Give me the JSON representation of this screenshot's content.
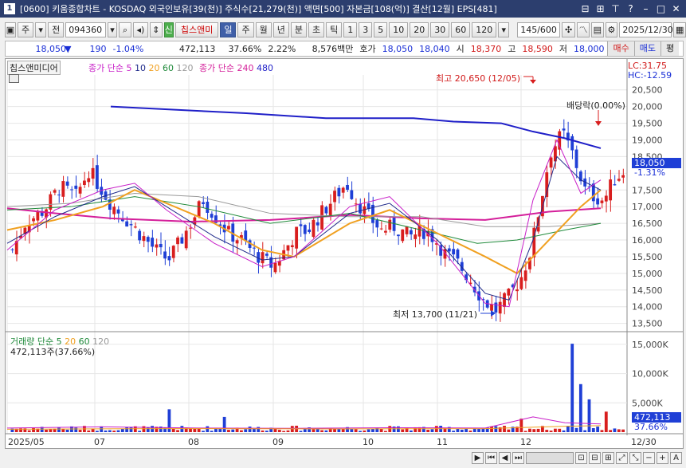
{
  "window": {
    "badge": "1",
    "title": "[0600] 키움종합차트 - KOSDAQ 외국인보유[39(천)] 주식수[21,279(천)] 액면[500] 자본금[108(억)] 결산[12월] EPS[481]"
  },
  "toolbar": {
    "type_btn": "주",
    "prev_btn": "전",
    "code": "094360",
    "company_btn": "칩스앤미디",
    "period_tabs": [
      "일",
      "주",
      "월",
      "년",
      "분",
      "초",
      "틱"
    ],
    "active_period": "일",
    "interval_btns": [
      "1",
      "3",
      "5",
      "10",
      "20",
      "30",
      "60",
      "120"
    ],
    "count": "145/600",
    "date": "2025/12/30"
  },
  "quote": {
    "price": "18,050",
    "change": "190",
    "change_pct": "-1.04%",
    "volume": "472,113",
    "vol_ratio": "37.66%",
    "turnover": "2.22%",
    "amount": "8,576백만",
    "bid_label": "호가",
    "ask": "18,050",
    "bid": "18,040",
    "open_label": "시",
    "open": "18,370",
    "high_label": "고",
    "high": "18,590",
    "low_label": "저",
    "low": "18,000",
    "buy_btn": "매수",
    "sell_btn": "매도",
    "eval_btn": "평"
  },
  "legend": {
    "name": "칩스앤미디어",
    "ma_short_label": "종가 단순 5",
    "ma_short_periods": [
      "10",
      "20",
      "60",
      "120"
    ],
    "ma_long_label": "종가 단순 240",
    "ma_long_periods": [
      "480"
    ],
    "lc": "LC:31.75",
    "hc": "HC:-12.59",
    "volume_label": "거래량 단순 5",
    "vol_ma": [
      "20",
      "60",
      "120"
    ],
    "volume_value": "472,113주(37.66%)"
  },
  "annotations": {
    "high": "최고 20,650 (12/05)",
    "low": "최저 13,700 (11/21)",
    "dividend": "배당락(0.00%)"
  },
  "price_axis": [
    "20,500",
    "20,000",
    "19,500",
    "19,000",
    "18,500",
    "18,000",
    "17,500",
    "17,000",
    "16,500",
    "16,000",
    "15,500",
    "15,000",
    "14,500",
    "14,000",
    "13,500"
  ],
  "current_price_box": "18,050",
  "current_pct_box": "-1.31%",
  "volume_axis": [
    "15,000K",
    "10,000K",
    "5,000K"
  ],
  "volume_box": "472,113",
  "volume_pct_box": "37.66%",
  "x_axis": [
    "2025/05",
    "07",
    "08",
    "09",
    "10",
    "11",
    "12",
    "12/30"
  ],
  "colors": {
    "up": "#d81e1e",
    "down": "#1f3fd6",
    "ma5": "#c81ec8",
    "ma10": "#1f2a8a",
    "ma20": "#f0a020",
    "ma60": "#1f8a3a",
    "ma120": "#9a9a9a",
    "ma240": "#d41f9a",
    "ma480": "#1f1fc8"
  },
  "chart_data": {
    "type": "candlestick",
    "series": [
      {
        "name": "종가 단순 5",
        "color": "#c81ec8"
      },
      {
        "name": "10",
        "color": "#1f2a8a"
      },
      {
        "name": "20",
        "color": "#f0a020"
      },
      {
        "name": "60",
        "color": "#1f8a3a"
      },
      {
        "name": "120",
        "color": "#9a9a9a"
      },
      {
        "name": "종가 단순 240",
        "color": "#d41f9a"
      },
      {
        "name": "480",
        "color": "#1f1fc8"
      }
    ],
    "ylim": [
      13300,
      20900
    ],
    "high": 20650,
    "low": 13700,
    "last": 18050
  }
}
